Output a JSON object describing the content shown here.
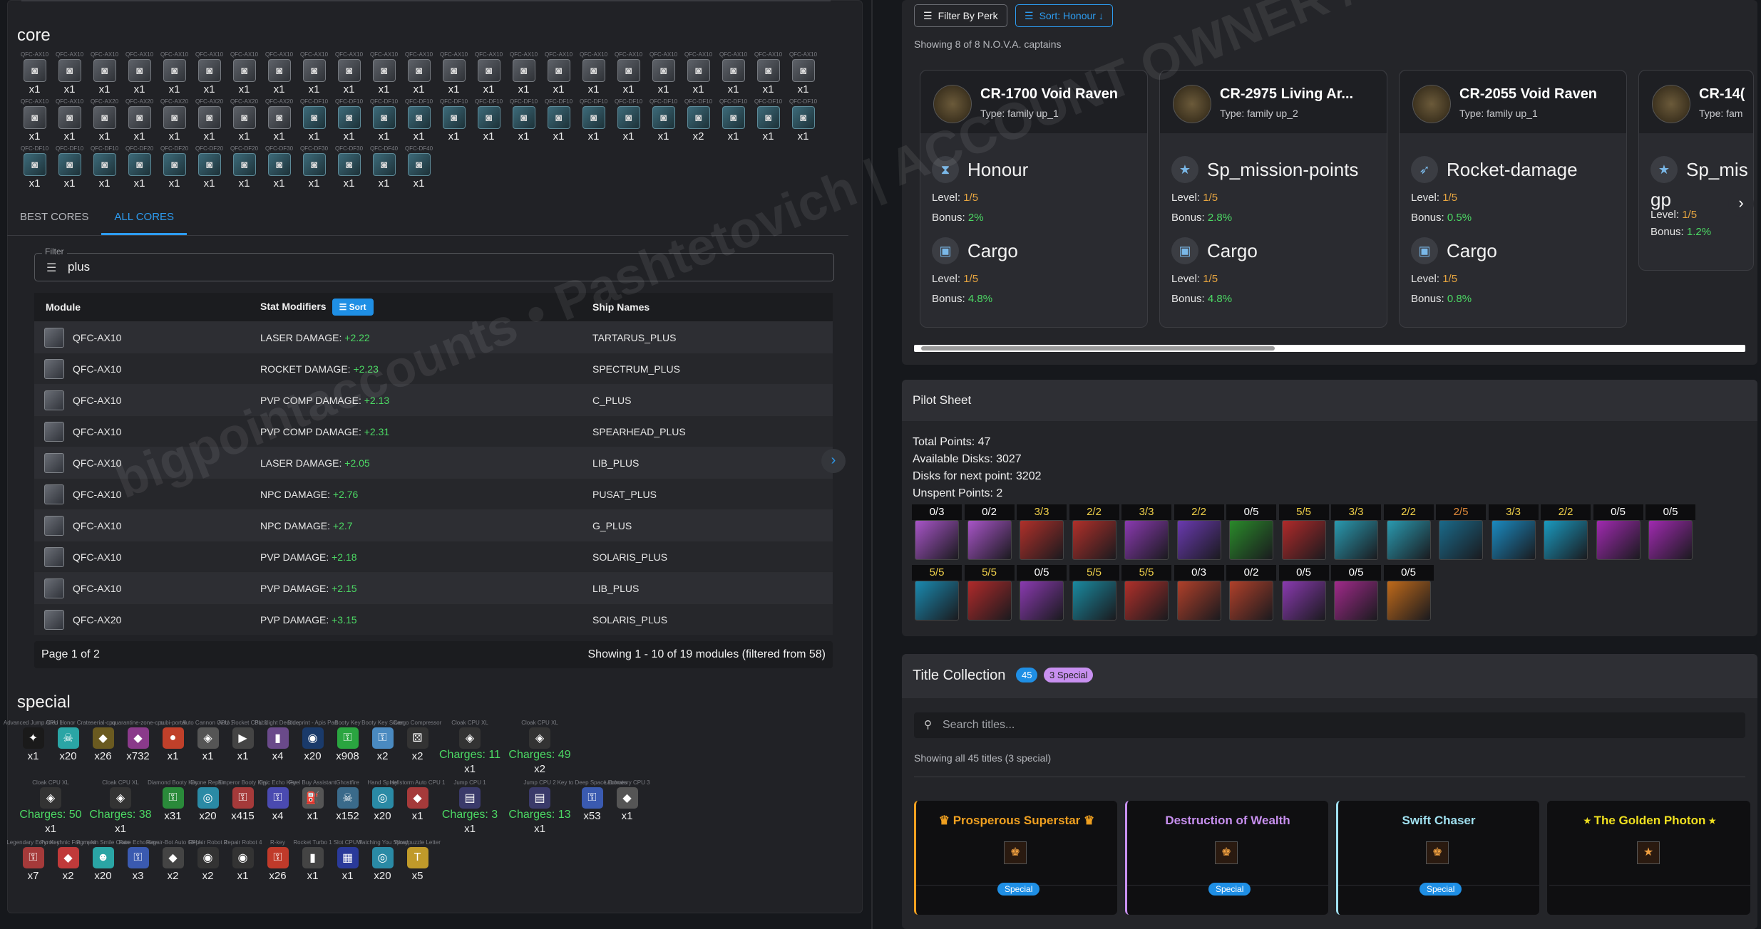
{
  "core": {
    "title": "core",
    "row1_caption": "QFC-AX10",
    "row1": [
      "x1",
      "x1",
      "x1",
      "x1",
      "x1",
      "x1",
      "x1",
      "x1",
      "x1",
      "x1",
      "x1",
      "x1",
      "x1",
      "x1",
      "x1",
      "x1",
      "x1",
      "x1",
      "x1",
      "x1",
      "x1",
      "x1",
      "x1"
    ],
    "row2_captions": [
      "QFC-AX10",
      "QFC-AX10",
      "QFC-AX20",
      "QFC-AX20",
      "QFC-AX20",
      "QFC-AX20",
      "QFC-AX20",
      "QFC-AX20",
      "QFC-DF10",
      "QFC-DF10",
      "QFC-DF10",
      "QFC-DF10",
      "QFC-DF10",
      "QFC-DF10",
      "QFC-DF10",
      "QFC-DF10",
      "QFC-DF10",
      "QFC-DF10",
      "QFC-DF10",
      "QFC-DF10",
      "QFC-DF10",
      "QFC-DF10",
      "QFC-DF10"
    ],
    "row2": [
      "x1",
      "x1",
      "x1",
      "x1",
      "x1",
      "x1",
      "x1",
      "x1",
      "x1",
      "x1",
      "x1",
      "x1",
      "x1",
      "x1",
      "x1",
      "x1",
      "x1",
      "x1",
      "x1",
      "x2",
      "x1",
      "x1",
      "x1"
    ],
    "row3_captions": [
      "QFC-DF10",
      "QFC-DF10",
      "QFC-DF10",
      "QFC-DF20",
      "QFC-DF20",
      "QFC-DF20",
      "QFC-DF20",
      "QFC-DF30",
      "QFC-DF30",
      "QFC-DF30",
      "QFC-DF40",
      "QFC-DF40"
    ],
    "row3": [
      "x1",
      "x1",
      "x1",
      "x1",
      "x1",
      "x1",
      "x1",
      "x1",
      "x1",
      "x1",
      "x1",
      "x1"
    ]
  },
  "tabs": [
    "BEST CORES",
    "ALL CORES"
  ],
  "filter": {
    "label": "Filter",
    "value": "plus"
  },
  "table": {
    "headers": {
      "module": "Module",
      "stat": "Stat Modifiers",
      "sort": "Sort",
      "ships": "Ship Names"
    },
    "rows": [
      {
        "module": "QFC-AX10",
        "stat": "LASER DAMAGE: ",
        "bonus": "+2.22",
        "ship": "TARTARUS_PLUS"
      },
      {
        "module": "QFC-AX10",
        "stat": "ROCKET DAMAGE: ",
        "bonus": "+2.23",
        "ship": "SPECTRUM_PLUS"
      },
      {
        "module": "QFC-AX10",
        "stat": "PVP COMP DAMAGE: ",
        "bonus": "+2.13",
        "ship": "C_PLUS"
      },
      {
        "module": "QFC-AX10",
        "stat": "PVP COMP DAMAGE: ",
        "bonus": "+2.31",
        "ship": "SPEARHEAD_PLUS"
      },
      {
        "module": "QFC-AX10",
        "stat": "LASER DAMAGE: ",
        "bonus": "+2.05",
        "ship": "LIB_PLUS"
      },
      {
        "module": "QFC-AX10",
        "stat": "NPC DAMAGE: ",
        "bonus": "+2.76",
        "ship": "PUSAT_PLUS"
      },
      {
        "module": "QFC-AX10",
        "stat": "NPC DAMAGE: ",
        "bonus": "+2.7",
        "ship": "G_PLUS"
      },
      {
        "module": "QFC-AX10",
        "stat": "PVP DAMAGE: ",
        "bonus": "+2.18",
        "ship": "SOLARIS_PLUS"
      },
      {
        "module": "QFC-AX10",
        "stat": "PVP DAMAGE: ",
        "bonus": "+2.15",
        "ship": "LIB_PLUS"
      },
      {
        "module": "QFC-AX20",
        "stat": "PVP DAMAGE: ",
        "bonus": "+3.15",
        "ship": "SOLARIS_PLUS"
      }
    ]
  },
  "pager": {
    "page": "Page 1 of 2",
    "showing": "Showing 1 - 10 of 19 modules (filtered from 58)"
  },
  "special": {
    "title": "special",
    "items": [
      {
        "cap": "Advanced Jump CPU 1",
        "count": "x1",
        "color": "#1a1a1a",
        "glyph": "✦"
      },
      {
        "cap": "Alien Honor Crate",
        "count": "x20",
        "color": "#2aa5a5",
        "glyph": "☠"
      },
      {
        "cap": "aerial-cpu",
        "count": "x26",
        "color": "#6a5a20",
        "glyph": "◆"
      },
      {
        "cap": "quarantine-zone-cpu",
        "count": "x732",
        "color": "#8a3a8a",
        "glyph": "◆"
      },
      {
        "cap": "cubi-portal",
        "count": "x1",
        "color": "#c0402a",
        "glyph": "●"
      },
      {
        "cap": "Auto Cannon CPU 1",
        "count": "x1",
        "color": "#555",
        "glyph": "◈"
      },
      {
        "cap": "Auto Rocket CPU 1",
        "count": "x1",
        "color": "#444",
        "glyph": "▶"
      },
      {
        "cap": "Backlight Decoder",
        "count": "x4",
        "color": "#6a4a8a",
        "glyph": "▮"
      },
      {
        "cap": "Blueprint - Apis Part",
        "count": "x20",
        "color": "#1a3a6a",
        "glyph": "◉"
      },
      {
        "cap": "Booty Key",
        "count": "x908",
        "color": "#2aa540",
        "glyph": "⚿"
      },
      {
        "cap": "Booty Key Silver",
        "count": "x2",
        "color": "#4a8ac0",
        "glyph": "⚿"
      },
      {
        "cap": "Cargo Compressor",
        "count": "x2",
        "color": "#333",
        "glyph": "⚄"
      },
      {
        "cap": "Cloak CPU XL",
        "count": "x1",
        "charges": "Charges: 11",
        "color": "#333",
        "glyph": "◈"
      },
      {
        "cap": "Cloak CPU XL",
        "count": "x2",
        "charges": "Charges: 49",
        "color": "#333",
        "glyph": "◈"
      },
      {
        "cap": "Cloak CPU XL",
        "count": "x1",
        "charges": "Charges: 50",
        "color": "#333",
        "glyph": "◈"
      },
      {
        "cap": "Cloak CPU XL",
        "count": "x1",
        "charges": "Charges: 38",
        "color": "#333",
        "glyph": "◈"
      },
      {
        "cap": "Diamond Booty Key",
        "count": "x31",
        "color": "#2a8a3a",
        "glyph": "⚿"
      },
      {
        "cap": "Drone Repair",
        "count": "x20",
        "color": "#2a8aa5",
        "glyph": "◎"
      },
      {
        "cap": "Emperor Booty Key",
        "count": "x415",
        "color": "#a53a3a",
        "glyph": "⚿"
      },
      {
        "cap": "Epic Echo Key",
        "count": "x4",
        "color": "#4a4ab0",
        "glyph": "⚿"
      },
      {
        "cap": "Fuel Buy Assistant",
        "count": "x1",
        "color": "#555",
        "glyph": "⛽"
      },
      {
        "cap": "Ghostfire",
        "count": "x152",
        "color": "#3a6a8a",
        "glyph": "☠"
      },
      {
        "cap": "Hand Spray",
        "count": "x20",
        "color": "#2a8aa5",
        "glyph": "◎"
      },
      {
        "cap": "Hellstorm Auto CPU 1",
        "count": "x1",
        "color": "#a53a3a",
        "glyph": "◆"
      },
      {
        "cap": "Jump CPU 1",
        "count": "x1",
        "charges": "Charges: 3",
        "color": "#3a3a6a",
        "glyph": "▤"
      },
      {
        "cap": "Jump CPU 2",
        "count": "x1",
        "charges": "Charges: 13",
        "color": "#3a3a6a",
        "glyph": "▤"
      },
      {
        "cap": "Key to Deep Space Echoes",
        "count": "x53",
        "color": "#3a5ab0",
        "glyph": "⚿"
      },
      {
        "cap": "Laboratory CPU 3",
        "count": "x1",
        "color": "#555",
        "glyph": "◆"
      },
      {
        "cap": "Legendary Echo Key",
        "count": "x7",
        "color": "#a53a3a",
        "glyph": "⚿"
      },
      {
        "cap": "Pyrotechnic Fragment",
        "count": "x2",
        "color": "#c03a3a",
        "glyph": "◆"
      },
      {
        "cap": "Pumpkin Smile Crate",
        "count": "x20",
        "color": "#2aa5a5",
        "glyph": "☻"
      },
      {
        "cap": "Rare Echo Key",
        "count": "x3",
        "color": "#3a5ab0",
        "glyph": "⚿"
      },
      {
        "cap": "Repair-Bot Auto CPU",
        "count": "x2",
        "color": "#444",
        "glyph": "◆"
      },
      {
        "cap": "Repair Robot 2",
        "count": "x2",
        "color": "#333",
        "glyph": "◉"
      },
      {
        "cap": "Repair Robot 4",
        "count": "x1",
        "color": "#333",
        "glyph": "◉"
      },
      {
        "cap": "R-key",
        "count": "x26",
        "color": "#c03a2a",
        "glyph": "⚿"
      },
      {
        "cap": "Rocket Turbo 1",
        "count": "x1",
        "color": "#444",
        "glyph": "▮"
      },
      {
        "cap": "Slot CPU 4",
        "count": "x1",
        "color": "#2a3a9a",
        "glyph": "▦"
      },
      {
        "cap": "Watching You Spray",
        "count": "x20",
        "color": "#2a8aa5",
        "glyph": "◎"
      },
      {
        "cap": "Wordpuzzle Letter",
        "count": "x5",
        "color": "#c09a2a",
        "glyph": "T"
      }
    ]
  },
  "captains": {
    "filter_btn": "Filter By Perk",
    "sort_btn": "Sort: Honour ↓",
    "showing": "Showing 8 of 8 N.O.V.A. captains",
    "cards": [
      {
        "name": "CR-1700 Void Raven",
        "type": "Type: family up_1",
        "p1": "Honour",
        "p1_icon": "⧗",
        "p1_lv": "1/5",
        "p1_bn": "2%",
        "p2": "Cargo",
        "p2_lv": "1/5",
        "p2_bn": "4.8%"
      },
      {
        "name": "CR-2975 Living Ar...",
        "type": "Type: family up_2",
        "p1": "Sp_mission-points",
        "p1_icon": "★",
        "p1_lv": "1/5",
        "p1_bn": "2.8%",
        "p2": "Cargo",
        "p2_lv": "1/5",
        "p2_bn": "4.8%"
      },
      {
        "name": "CR-2055 Void Raven",
        "type": "Type: family up_1",
        "p1": "Rocket-damage",
        "p1_icon": "➶",
        "p1_lv": "1/5",
        "p1_bn": "0.5%",
        "p2": "Cargo",
        "p2_lv": "1/5",
        "p2_bn": "0.8%"
      },
      {
        "name": "CR-14(",
        "type": "Type: fam",
        "p1": "Sp_mis",
        "p1_extra": "gp",
        "p1_icon": "★",
        "p1_lv": "1/5",
        "p1_bn": "1.2%"
      }
    ],
    "level_label": "Level: ",
    "bonus_label": "Bonus: "
  },
  "pilot": {
    "title": "Pilot Sheet",
    "total": "Total Points: 47",
    "avail": "Available Disks: 3027",
    "next": "Disks for next point: 3202",
    "unspent": "Unspent Points: 2",
    "row1": [
      {
        "v": "0/3",
        "c": "w",
        "bg": "#a855c8"
      },
      {
        "v": "0/2",
        "c": "w",
        "bg": "#a855c8"
      },
      {
        "v": "3/3",
        "c": "g",
        "bg": "#b0302a"
      },
      {
        "v": "2/2",
        "c": "g",
        "bg": "#b0302a"
      },
      {
        "v": "3/3",
        "c": "g",
        "bg": "#8a3ab0"
      },
      {
        "v": "2/2",
        "c": "g",
        "bg": "#6a3ab0"
      },
      {
        "v": "0/5",
        "c": "w",
        "bg": "#2a8a2a"
      },
      {
        "v": "5/5",
        "c": "g",
        "bg": "#b02a2a"
      },
      {
        "v": "3/3",
        "c": "g",
        "bg": "#2a9ab0"
      },
      {
        "v": "2/2",
        "c": "g",
        "bg": "#2a9ab0"
      },
      {
        "v": "2/5",
        "c": "o",
        "bg": "#1a6a8a"
      },
      {
        "v": "3/3",
        "c": "g",
        "bg": "#1a8ac0"
      },
      {
        "v": "2/2",
        "c": "g",
        "bg": "#1a9ac0"
      },
      {
        "v": "0/5",
        "c": "w",
        "bg": "#a02ab0"
      },
      {
        "v": "0/5",
        "c": "w",
        "bg": "#a02ab0"
      }
    ],
    "row2": [
      {
        "v": "5/5",
        "c": "g",
        "bg": "#1a8ab0"
      },
      {
        "v": "5/5",
        "c": "g",
        "bg": "#b02a2a"
      },
      {
        "v": "0/5",
        "c": "w",
        "bg": "#8a3ab0"
      },
      {
        "v": "5/5",
        "c": "g",
        "bg": "#1a8aa0"
      },
      {
        "v": "5/5",
        "c": "g",
        "bg": "#b0302a"
      },
      {
        "v": "0/3",
        "c": "w",
        "bg": "#b0402a"
      },
      {
        "v": "0/2",
        "c": "w",
        "bg": "#b0402a"
      },
      {
        "v": "0/5",
        "c": "w",
        "bg": "#8a3ab0"
      },
      {
        "v": "0/5",
        "c": "w",
        "bg": "#a02a8a"
      },
      {
        "v": "0/5",
        "c": "w",
        "bg": "#c06a1a"
      }
    ]
  },
  "titles": {
    "title": "Title Collection",
    "count": "45",
    "special": "3 Special",
    "search_ph": "Search titles...",
    "showing": "Showing all 45 titles (3 special)",
    "cards": [
      {
        "name": "♛ Prosperous Superstar ♛",
        "color": "#f0a020",
        "border": "#f0a020",
        "badge": "Special"
      },
      {
        "name": "Destruction of Wealth",
        "color": "#c890f0",
        "border": "#c890f0",
        "badge": "Special"
      },
      {
        "name": "Swift Chaser",
        "color": "#a0e0f0",
        "border": "#a0e0f0",
        "badge": "Special"
      },
      {
        "name": "⭑ The Golden Photon ⭑",
        "color": "#f0e020",
        "border": "#0f0f11",
        "badge": ""
      }
    ]
  }
}
